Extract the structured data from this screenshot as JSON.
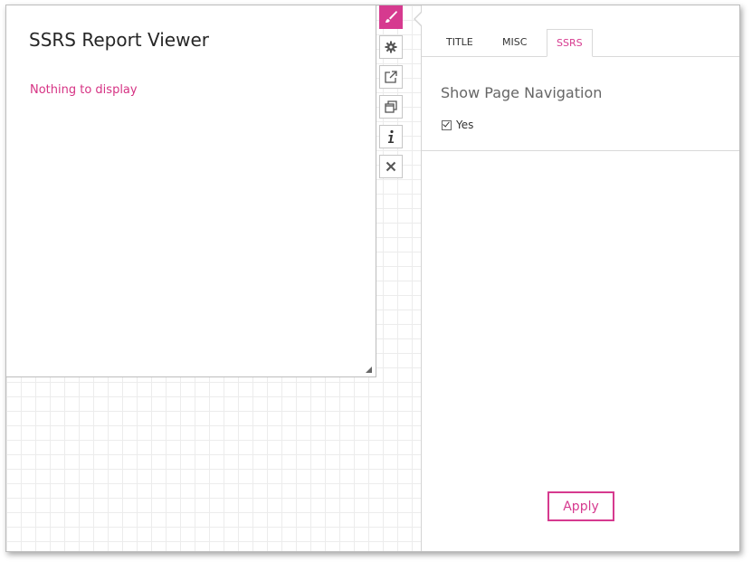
{
  "webpart": {
    "title": "SSRS Report Viewer",
    "empty_message": "Nothing to display"
  },
  "toolbar": {
    "buttons": [
      {
        "name": "brush-icon",
        "active": true
      },
      {
        "name": "gear-icon",
        "active": false
      },
      {
        "name": "external-link-icon",
        "active": false
      },
      {
        "name": "restore-window-icon",
        "active": false
      },
      {
        "name": "info-icon",
        "active": false
      },
      {
        "name": "close-icon",
        "active": false
      }
    ]
  },
  "panel": {
    "tabs": [
      {
        "label": "TITLE",
        "active": false
      },
      {
        "label": "MISC",
        "active": false
      },
      {
        "label": "SSRS",
        "active": true
      }
    ],
    "section_title": "Show Page Navigation",
    "checkbox_label": "Yes",
    "checkbox_checked": true,
    "apply_label": "Apply"
  },
  "colors": {
    "accent": "#d63a8f",
    "link": "#d63384"
  }
}
